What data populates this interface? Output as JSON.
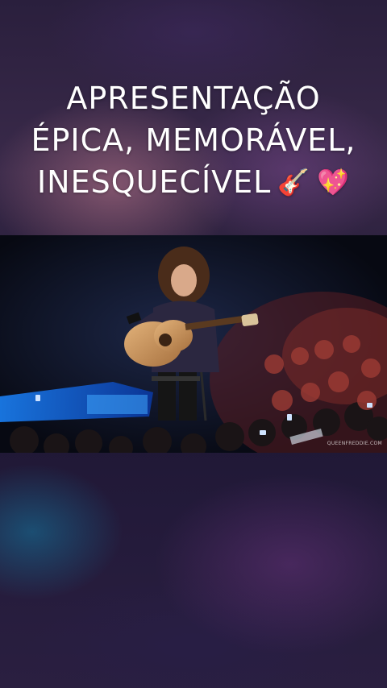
{
  "headline": {
    "line1": "APRESENTAÇÃO",
    "line2": "ÉPICA, MEMORÁVEL,",
    "line3": "INESQUECÍVEL",
    "emoji1": "🎸",
    "emoji2": "💖"
  },
  "video": {
    "watermark": "QUEENFREDDIE.COM",
    "description_icon": "concert-video-frame"
  },
  "colors": {
    "stage_blue": "#1f6fe0",
    "crowd_red": "#b5423a",
    "background_dark": "#1a1228",
    "text": "#ffffff"
  }
}
